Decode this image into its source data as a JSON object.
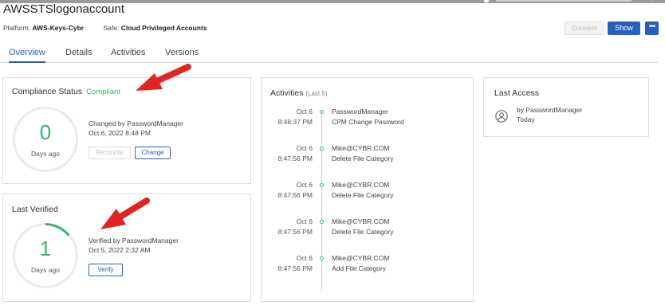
{
  "header": {
    "title": "AWSSTSlogonaccount",
    "platform_label": "Platform:",
    "platform_value": "AWS-Keys-Cybr",
    "safe_label": "Safe:",
    "safe_value": "Cloud Privileged Accounts",
    "connect_label": "Connect",
    "show_label": "Show",
    "more_label": "•••"
  },
  "tabs": [
    {
      "label": "Overview",
      "active": true
    },
    {
      "label": "Details",
      "active": false
    },
    {
      "label": "Activities",
      "active": false
    },
    {
      "label": "Versions",
      "active": false
    }
  ],
  "compliance": {
    "title": "Compliance Status",
    "status": "Compliant",
    "count": "0",
    "count_label": "Days ago",
    "changed_by": "Changed by PasswordManager",
    "changed_date": "Oct 6, 2022 8:48 PM",
    "reconcile_label": "Reconcile",
    "change_label": "Change"
  },
  "verified": {
    "title": "Last Verified",
    "count": "1",
    "count_label": "Days ago",
    "verified_by": "Verified by PasswordManager",
    "verified_date": "Oct 5, 2022 2:32 AM",
    "verify_label": "Verify"
  },
  "activities": {
    "title": "Activities",
    "subtitle": "(Last 5)",
    "items": [
      {
        "date": "Oct 6",
        "time": "8:48:37 PM",
        "user": "PasswordManager",
        "action": "CPM Change Password"
      },
      {
        "date": "Oct 6",
        "time": "8:47:56 PM",
        "user": "Mike@CYBR.COM",
        "action": "Delete File Category"
      },
      {
        "date": "Oct 6",
        "time": "8:47:56 PM",
        "user": "Mike@CYBR.COM",
        "action": "Delete File Category"
      },
      {
        "date": "Oct 6",
        "time": "8:47:56 PM",
        "user": "Mike@CYBR.COM",
        "action": "Delete File Category"
      },
      {
        "date": "Oct 6",
        "time": "8:47:56 PM",
        "user": "Mike@CYBR.COM",
        "action": "Add File Category"
      }
    ]
  },
  "last_access": {
    "title": "Last Access",
    "by": "by PasswordManager",
    "when": "Today"
  },
  "colors": {
    "accent": "#2a5ebf",
    "success": "#3cb26e",
    "annotation": "#e02424"
  }
}
